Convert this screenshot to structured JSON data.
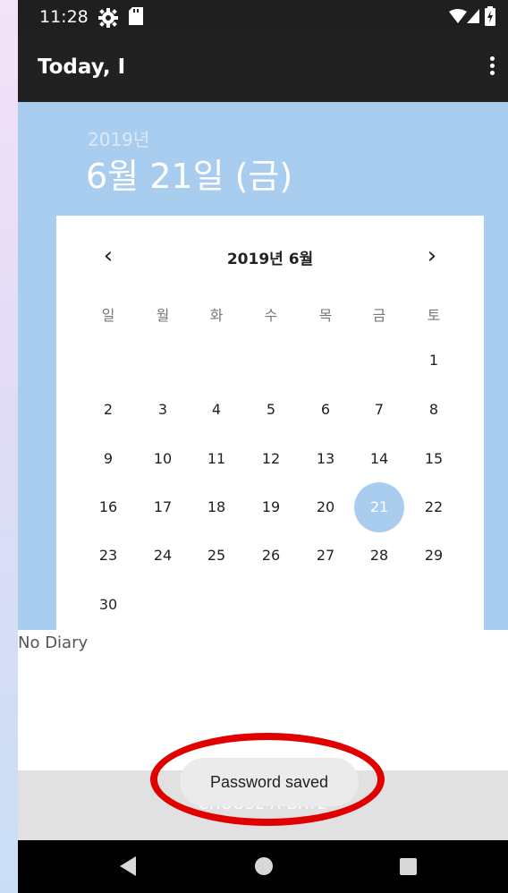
{
  "status_bar": {
    "time": "11:28"
  },
  "app_bar": {
    "title": "Today, I"
  },
  "header": {
    "year": "2019년",
    "date": "6월 21일 (금)"
  },
  "calendar": {
    "month_label": "2019년 6월",
    "prev_icon": "chevron-left-icon",
    "next_icon": "chevron-right-icon",
    "weekdays": [
      "일",
      "월",
      "화",
      "수",
      "목",
      "금",
      "토"
    ],
    "selected_day": "21",
    "weeks": [
      [
        "",
        "",
        "",
        "",
        "",
        "",
        "1"
      ],
      [
        "2",
        "3",
        "4",
        "5",
        "6",
        "7",
        "8"
      ],
      [
        "9",
        "10",
        "11",
        "12",
        "13",
        "14",
        "15"
      ],
      [
        "16",
        "17",
        "18",
        "19",
        "20",
        "21",
        "22"
      ],
      [
        "23",
        "24",
        "25",
        "26",
        "27",
        "28",
        "29"
      ],
      [
        "30",
        "",
        "",
        "",
        "",
        "",
        ""
      ]
    ],
    "accent_color": "#a9cdef"
  },
  "content": {
    "empty_text": "No Diary"
  },
  "bottom": {
    "button_label": "CHOOSE A DATE"
  },
  "toast": {
    "message": "Password saved"
  },
  "annotation": {
    "color": "#e00000"
  }
}
